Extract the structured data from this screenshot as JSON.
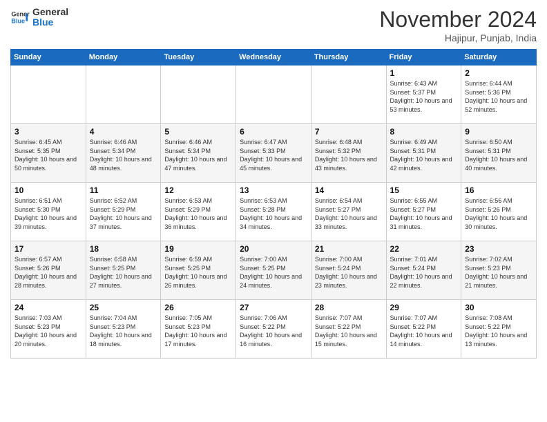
{
  "header": {
    "logo_line1": "General",
    "logo_line2": "Blue",
    "month": "November 2024",
    "location": "Hajipur, Punjab, India"
  },
  "weekdays": [
    "Sunday",
    "Monday",
    "Tuesday",
    "Wednesday",
    "Thursday",
    "Friday",
    "Saturday"
  ],
  "weeks": [
    [
      {
        "day": "",
        "info": ""
      },
      {
        "day": "",
        "info": ""
      },
      {
        "day": "",
        "info": ""
      },
      {
        "day": "",
        "info": ""
      },
      {
        "day": "",
        "info": ""
      },
      {
        "day": "1",
        "info": "Sunrise: 6:43 AM\nSunset: 5:37 PM\nDaylight: 10 hours and 53 minutes."
      },
      {
        "day": "2",
        "info": "Sunrise: 6:44 AM\nSunset: 5:36 PM\nDaylight: 10 hours and 52 minutes."
      }
    ],
    [
      {
        "day": "3",
        "info": "Sunrise: 6:45 AM\nSunset: 5:35 PM\nDaylight: 10 hours and 50 minutes."
      },
      {
        "day": "4",
        "info": "Sunrise: 6:46 AM\nSunset: 5:34 PM\nDaylight: 10 hours and 48 minutes."
      },
      {
        "day": "5",
        "info": "Sunrise: 6:46 AM\nSunset: 5:34 PM\nDaylight: 10 hours and 47 minutes."
      },
      {
        "day": "6",
        "info": "Sunrise: 6:47 AM\nSunset: 5:33 PM\nDaylight: 10 hours and 45 minutes."
      },
      {
        "day": "7",
        "info": "Sunrise: 6:48 AM\nSunset: 5:32 PM\nDaylight: 10 hours and 43 minutes."
      },
      {
        "day": "8",
        "info": "Sunrise: 6:49 AM\nSunset: 5:31 PM\nDaylight: 10 hours and 42 minutes."
      },
      {
        "day": "9",
        "info": "Sunrise: 6:50 AM\nSunset: 5:31 PM\nDaylight: 10 hours and 40 minutes."
      }
    ],
    [
      {
        "day": "10",
        "info": "Sunrise: 6:51 AM\nSunset: 5:30 PM\nDaylight: 10 hours and 39 minutes."
      },
      {
        "day": "11",
        "info": "Sunrise: 6:52 AM\nSunset: 5:29 PM\nDaylight: 10 hours and 37 minutes."
      },
      {
        "day": "12",
        "info": "Sunrise: 6:53 AM\nSunset: 5:29 PM\nDaylight: 10 hours and 36 minutes."
      },
      {
        "day": "13",
        "info": "Sunrise: 6:53 AM\nSunset: 5:28 PM\nDaylight: 10 hours and 34 minutes."
      },
      {
        "day": "14",
        "info": "Sunrise: 6:54 AM\nSunset: 5:27 PM\nDaylight: 10 hours and 33 minutes."
      },
      {
        "day": "15",
        "info": "Sunrise: 6:55 AM\nSunset: 5:27 PM\nDaylight: 10 hours and 31 minutes."
      },
      {
        "day": "16",
        "info": "Sunrise: 6:56 AM\nSunset: 5:26 PM\nDaylight: 10 hours and 30 minutes."
      }
    ],
    [
      {
        "day": "17",
        "info": "Sunrise: 6:57 AM\nSunset: 5:26 PM\nDaylight: 10 hours and 28 minutes."
      },
      {
        "day": "18",
        "info": "Sunrise: 6:58 AM\nSunset: 5:25 PM\nDaylight: 10 hours and 27 minutes."
      },
      {
        "day": "19",
        "info": "Sunrise: 6:59 AM\nSunset: 5:25 PM\nDaylight: 10 hours and 26 minutes."
      },
      {
        "day": "20",
        "info": "Sunrise: 7:00 AM\nSunset: 5:25 PM\nDaylight: 10 hours and 24 minutes."
      },
      {
        "day": "21",
        "info": "Sunrise: 7:00 AM\nSunset: 5:24 PM\nDaylight: 10 hours and 23 minutes."
      },
      {
        "day": "22",
        "info": "Sunrise: 7:01 AM\nSunset: 5:24 PM\nDaylight: 10 hours and 22 minutes."
      },
      {
        "day": "23",
        "info": "Sunrise: 7:02 AM\nSunset: 5:23 PM\nDaylight: 10 hours and 21 minutes."
      }
    ],
    [
      {
        "day": "24",
        "info": "Sunrise: 7:03 AM\nSunset: 5:23 PM\nDaylight: 10 hours and 20 minutes."
      },
      {
        "day": "25",
        "info": "Sunrise: 7:04 AM\nSunset: 5:23 PM\nDaylight: 10 hours and 18 minutes."
      },
      {
        "day": "26",
        "info": "Sunrise: 7:05 AM\nSunset: 5:23 PM\nDaylight: 10 hours and 17 minutes."
      },
      {
        "day": "27",
        "info": "Sunrise: 7:06 AM\nSunset: 5:22 PM\nDaylight: 10 hours and 16 minutes."
      },
      {
        "day": "28",
        "info": "Sunrise: 7:07 AM\nSunset: 5:22 PM\nDaylight: 10 hours and 15 minutes."
      },
      {
        "day": "29",
        "info": "Sunrise: 7:07 AM\nSunset: 5:22 PM\nDaylight: 10 hours and 14 minutes."
      },
      {
        "day": "30",
        "info": "Sunrise: 7:08 AM\nSunset: 5:22 PM\nDaylight: 10 hours and 13 minutes."
      }
    ]
  ]
}
